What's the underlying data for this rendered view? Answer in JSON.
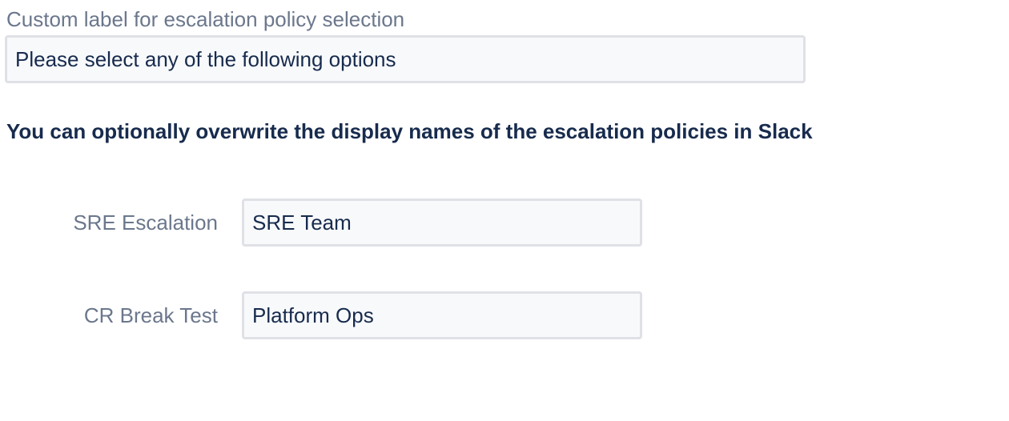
{
  "custom_label": {
    "label": "Custom label for escalation policy selection",
    "value": "Please select any of the following options"
  },
  "overrides": {
    "heading": "You can optionally overwrite the display names of the escalation policies in Slack",
    "rows": [
      {
        "policy_name": "SRE Escalation",
        "display_name": "SRE Team"
      },
      {
        "policy_name": "CR Break Test",
        "display_name": "Platform Ops"
      }
    ]
  }
}
